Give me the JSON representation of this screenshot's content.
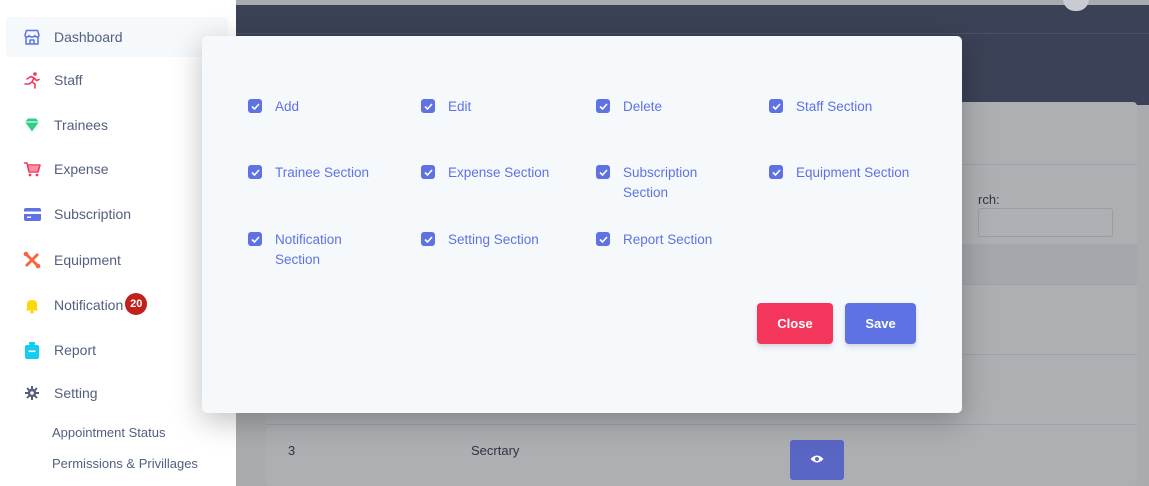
{
  "sidebar": {
    "items": [
      {
        "label": "Dashboard",
        "icon": "store-icon",
        "color": "#5e72e4"
      },
      {
        "label": "Staff",
        "icon": "running-person-icon",
        "color": "#f5365c"
      },
      {
        "label": "Trainees",
        "icon": "diamond-icon",
        "color": "#2dce89"
      },
      {
        "label": "Expense",
        "icon": "cart-icon",
        "color": "#f5365c"
      },
      {
        "label": "Subscription",
        "icon": "card-icon",
        "color": "#5e72e4"
      },
      {
        "label": "Equipment",
        "icon": "tools-icon",
        "color": "#fb6340"
      },
      {
        "label": "Notification",
        "icon": "bell-icon",
        "color": "#ffd600",
        "badge": "20"
      },
      {
        "label": "Report",
        "icon": "briefcase-icon",
        "color": "#11cdef"
      },
      {
        "label": "Setting",
        "icon": "gear-icon",
        "color": "#525f7f"
      }
    ],
    "sub_items": [
      {
        "label": "Appointment Status"
      },
      {
        "label": "Permissions & Privillages"
      }
    ]
  },
  "background_page": {
    "search_label": "rch:",
    "rows": [
      {
        "id": "3",
        "name": "Secrtary"
      }
    ]
  },
  "modal": {
    "permissions": [
      {
        "label": "Add",
        "checked": true
      },
      {
        "label": "Edit",
        "checked": true
      },
      {
        "label": "Delete",
        "checked": true
      },
      {
        "label": "Staff Section",
        "checked": true
      },
      {
        "label": "Trainee Section",
        "checked": true
      },
      {
        "label": "Expense Section",
        "checked": true
      },
      {
        "label": "Subscription Section",
        "checked": true
      },
      {
        "label": "Equipment Section",
        "checked": true
      },
      {
        "label": "Notification Section",
        "checked": true
      },
      {
        "label": "Setting Section",
        "checked": true
      },
      {
        "label": "Report Section",
        "checked": true
      }
    ],
    "close_label": "Close",
    "save_label": "Save"
  },
  "colors": {
    "primary": "#5e72e4",
    "danger": "#f5365c",
    "topbar": "#3b4257"
  }
}
